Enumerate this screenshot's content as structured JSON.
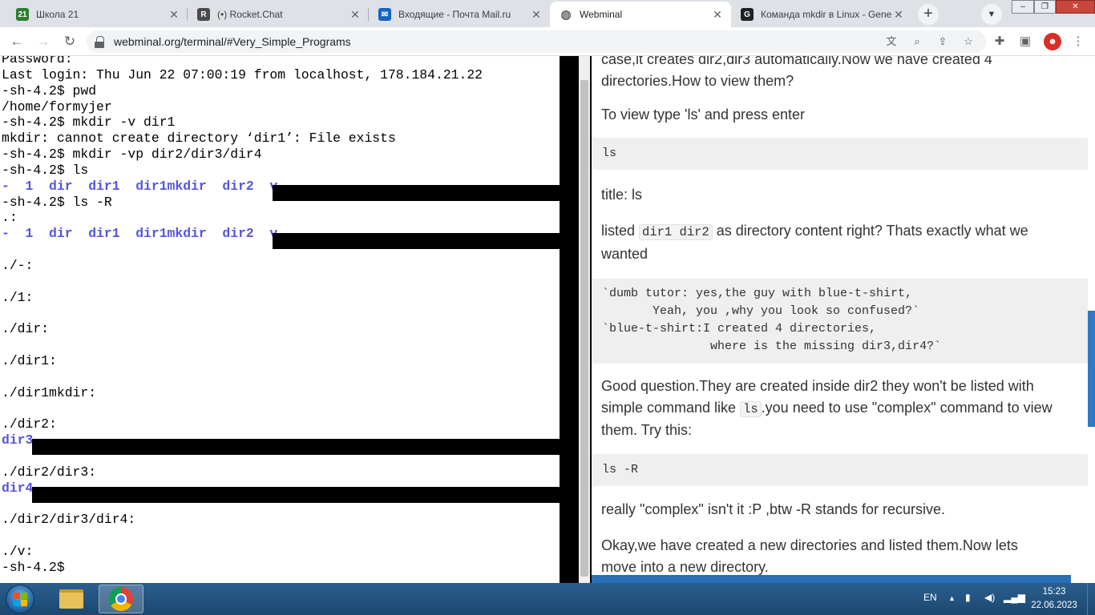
{
  "tabs": [
    {
      "title": "Школа 21",
      "icon": "school21-icon",
      "color": "#2e7d32",
      "glyph": "21"
    },
    {
      "title": "(•) Rocket.Chat",
      "icon": "rocketchat-icon",
      "color": "#4a4a4a",
      "glyph": "R"
    },
    {
      "title": "Входящие - Почта Mail.ru",
      "icon": "mail-icon",
      "color": "#1565c0",
      "glyph": "✉"
    },
    {
      "title": "Webminal",
      "icon": "globe-icon",
      "color": "#5f6368",
      "glyph": "◍"
    },
    {
      "title": "Команда mkdir в Linux - Gene",
      "icon": "g-icon",
      "color": "#202124",
      "glyph": "G"
    }
  ],
  "address": {
    "url": "webminal.org/terminal/#Very_Simple_Programs"
  },
  "terminal": {
    "lines": [
      {
        "segs": [
          {
            "t": "Password:"
          }
        ]
      },
      {
        "segs": [
          {
            "t": "Last login: Thu Jun 22 07:00:19 from localhost, 178.184.21.22"
          }
        ]
      },
      {
        "segs": [
          {
            "t": "-sh-4.2$ pwd"
          }
        ]
      },
      {
        "segs": [
          {
            "t": "/home/formyjer"
          }
        ]
      },
      {
        "segs": [
          {
            "t": "-sh-4.2$ mkdir -v dir1"
          }
        ]
      },
      {
        "segs": [
          {
            "t": "mkdir: cannot create directory ‘dir1’: File exists"
          }
        ]
      },
      {
        "segs": [
          {
            "t": "-sh-4.2$ mkdir -vp dir2/dir3/dir4"
          }
        ]
      },
      {
        "segs": [
          {
            "t": "-sh-4.2$ ls"
          }
        ]
      },
      {
        "segs": [
          {
            "t": "-  1  dir  dir1  dir1mkdir  dir2  v",
            "blue": true
          }
        ]
      },
      {
        "segs": [
          {
            "t": "-sh-4.2$ ls -R"
          }
        ]
      },
      {
        "segs": [
          {
            "t": ".:"
          }
        ]
      },
      {
        "segs": [
          {
            "t": "-  1  dir  dir1  dir1mkdir  dir2  v",
            "blue": true
          }
        ]
      },
      {
        "segs": [
          {
            "t": ""
          }
        ]
      },
      {
        "segs": [
          {
            "t": "./-:"
          }
        ]
      },
      {
        "segs": [
          {
            "t": ""
          }
        ]
      },
      {
        "segs": [
          {
            "t": "./1:"
          }
        ]
      },
      {
        "segs": [
          {
            "t": ""
          }
        ]
      },
      {
        "segs": [
          {
            "t": "./dir:"
          }
        ]
      },
      {
        "segs": [
          {
            "t": ""
          }
        ]
      },
      {
        "segs": [
          {
            "t": "./dir1:"
          }
        ]
      },
      {
        "segs": [
          {
            "t": ""
          }
        ]
      },
      {
        "segs": [
          {
            "t": "./dir1mkdir:"
          }
        ]
      },
      {
        "segs": [
          {
            "t": ""
          }
        ]
      },
      {
        "segs": [
          {
            "t": "./dir2:"
          }
        ]
      },
      {
        "segs": [
          {
            "t": "dir3",
            "blue": true
          }
        ]
      },
      {
        "segs": [
          {
            "t": ""
          }
        ]
      },
      {
        "segs": [
          {
            "t": "./dir2/dir3:"
          }
        ]
      },
      {
        "segs": [
          {
            "t": "dir4",
            "blue": true
          }
        ]
      },
      {
        "segs": [
          {
            "t": ""
          }
        ]
      },
      {
        "segs": [
          {
            "t": "./dir2/dir3/dir4:"
          }
        ]
      },
      {
        "segs": [
          {
            "t": ""
          }
        ]
      },
      {
        "segs": [
          {
            "t": "./v:"
          }
        ]
      },
      {
        "segs": [
          {
            "t": "-sh-4.2$ "
          }
        ]
      }
    ]
  },
  "tutorial": {
    "p1a": "case,it creates dir2,dir3 automatically.Now we have created 4",
    "p1b": "directories.How to view them?",
    "p2": "To view type 'ls' and press enter",
    "code1": "ls",
    "p3": "title: ls",
    "p4_pre": "listed ",
    "p4_code": "dir1 dir2",
    "p4_post": " as directory content right? Thats exactly what we",
    "p4b": "wanted",
    "code2": "`dumb tutor: yes,the guy with blue-t-shirt,\n       Yeah, you ,why you look so confused?`\n`blue-t-shirt:I created 4 directories,\n               where is the missing dir3,dir4?`",
    "p5a": "Good question.They are created inside dir2 they won't be listed with",
    "p5b_pre": "simple command like ",
    "p5b_code": "ls",
    "p5b_post": ".you need to use \"complex\" command to view",
    "p5c": "them. Try this:",
    "code3": "ls -R",
    "p6": "really \"complex\" isn't it :P ,btw -R stands for recursive.",
    "p7a": "Okay,we have created a new directories and listed them.Now lets",
    "p7b": "move into a new directory."
  },
  "taskbar": {
    "lang": "EN",
    "time": "15:23",
    "date": "22.06.2023"
  }
}
